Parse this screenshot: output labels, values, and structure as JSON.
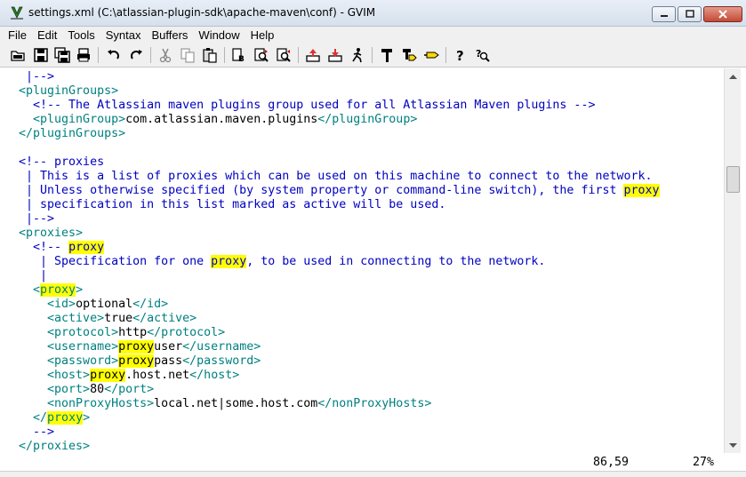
{
  "window": {
    "title": "settings.xml (C:\\atlassian-plugin-sdk\\apache-maven\\conf) - GVIM",
    "controls": [
      "minimize-icon",
      "maximize-icon",
      "close-icon"
    ]
  },
  "menu": [
    "File",
    "Edit",
    "Tools",
    "Syntax",
    "Buffers",
    "Window",
    "Help"
  ],
  "toolbar": [
    "open-icon",
    "save-icon",
    "save-all-icon",
    "print-icon",
    "undo-icon",
    "redo-icon",
    "cut-icon",
    "copy-icon",
    "paste-icon",
    "replace-icon",
    "find-next-icon",
    "find-prev-icon",
    "load-session-icon",
    "save-session-icon",
    "run-script-icon",
    "make-icon",
    "build-tags-icon",
    "jump-tag-icon",
    "help-icon",
    "find-help-icon"
  ],
  "editor": {
    "highlight_word": "proxy",
    "lines": [
      [
        {
          "t": "   |-->",
          "c": "cmt"
        }
      ],
      [
        {
          "t": "  <pluginGroups>",
          "c": "tag"
        }
      ],
      [
        {
          "t": "    <!-- The Atlassian maven plugins group used for all Atlassian Maven plugins -->",
          "c": "cmt"
        }
      ],
      [
        {
          "t": "    <pluginGroup>",
          "c": "tag"
        },
        {
          "t": "com.atlassian.maven.plugins",
          "c": ""
        },
        {
          "t": "</pluginGroup>",
          "c": "tag"
        }
      ],
      [
        {
          "t": "  </pluginGroups>",
          "c": "tag"
        }
      ],
      [
        {
          "t": "",
          "c": ""
        }
      ],
      [
        {
          "t": "  <!-- proxies",
          "c": "cmt"
        }
      ],
      [
        {
          "t": "   | This is a list of proxies which can be used on this machine to connect to the network.",
          "c": "cmt"
        }
      ],
      [
        {
          "t": "   | Unless otherwise specified (by system property or command-line switch), the first ",
          "c": "cmt"
        },
        {
          "t": "proxy",
          "c": "cmt hl"
        }
      ],
      [
        {
          "t": "   | specification in this list marked as active will be used.",
          "c": "cmt"
        }
      ],
      [
        {
          "t": "   |-->",
          "c": "cmt"
        }
      ],
      [
        {
          "t": "  <proxies>",
          "c": "tag"
        }
      ],
      [
        {
          "t": "    <!-- ",
          "c": "cmt"
        },
        {
          "t": "proxy",
          "c": "cmt hl"
        }
      ],
      [
        {
          "t": "     | Specification for one ",
          "c": "cmt"
        },
        {
          "t": "proxy",
          "c": "cmt hl"
        },
        {
          "t": ", to be used in connecting to the network.",
          "c": "cmt"
        }
      ],
      [
        {
          "t": "     |",
          "c": "cmt"
        }
      ],
      [
        {
          "t": "    <",
          "c": "tag"
        },
        {
          "t": "proxy",
          "c": "tag hl"
        },
        {
          "t": ">",
          "c": "tag"
        }
      ],
      [
        {
          "t": "      <id>",
          "c": "tag"
        },
        {
          "t": "optional",
          "c": ""
        },
        {
          "t": "</id>",
          "c": "tag"
        }
      ],
      [
        {
          "t": "      <active>",
          "c": "tag"
        },
        {
          "t": "true",
          "c": ""
        },
        {
          "t": "</active>",
          "c": "tag"
        }
      ],
      [
        {
          "t": "      <protocol>",
          "c": "tag"
        },
        {
          "t": "http",
          "c": ""
        },
        {
          "t": "</protocol>",
          "c": "tag"
        }
      ],
      [
        {
          "t": "      <username>",
          "c": "tag"
        },
        {
          "t": "proxy",
          "c": "hl"
        },
        {
          "t": "user",
          "c": ""
        },
        {
          "t": "</username>",
          "c": "tag"
        }
      ],
      [
        {
          "t": "      <password>",
          "c": "tag"
        },
        {
          "t": "proxy",
          "c": "hl"
        },
        {
          "t": "pass",
          "c": ""
        },
        {
          "t": "</password>",
          "c": "tag"
        }
      ],
      [
        {
          "t": "      <host>",
          "c": "tag"
        },
        {
          "t": "proxy",
          "c": "hl"
        },
        {
          "t": ".host.net",
          "c": ""
        },
        {
          "t": "</host>",
          "c": "tag"
        }
      ],
      [
        {
          "t": "      <port>",
          "c": "tag"
        },
        {
          "t": "80",
          "c": ""
        },
        {
          "t": "</port>",
          "c": "tag"
        }
      ],
      [
        {
          "t": "      <nonProxyHosts>",
          "c": "tag"
        },
        {
          "t": "local.net|some.host.com",
          "c": ""
        },
        {
          "t": "</nonProxyHosts>",
          "c": "tag"
        }
      ],
      [
        {
          "t": "    </",
          "c": "tag"
        },
        {
          "t": "proxy",
          "c": "tag hl"
        },
        {
          "t": ">",
          "c": "tag"
        }
      ],
      [
        {
          "t": "    -->",
          "c": "cmt"
        }
      ],
      [
        {
          "t": "  </proxies>",
          "c": "tag"
        }
      ]
    ]
  },
  "status": {
    "cursor": "86,59",
    "percent": "27%"
  },
  "colors": {
    "tag": "#008080",
    "comment": "#0000c0",
    "search_highlight": "#ffff00"
  }
}
